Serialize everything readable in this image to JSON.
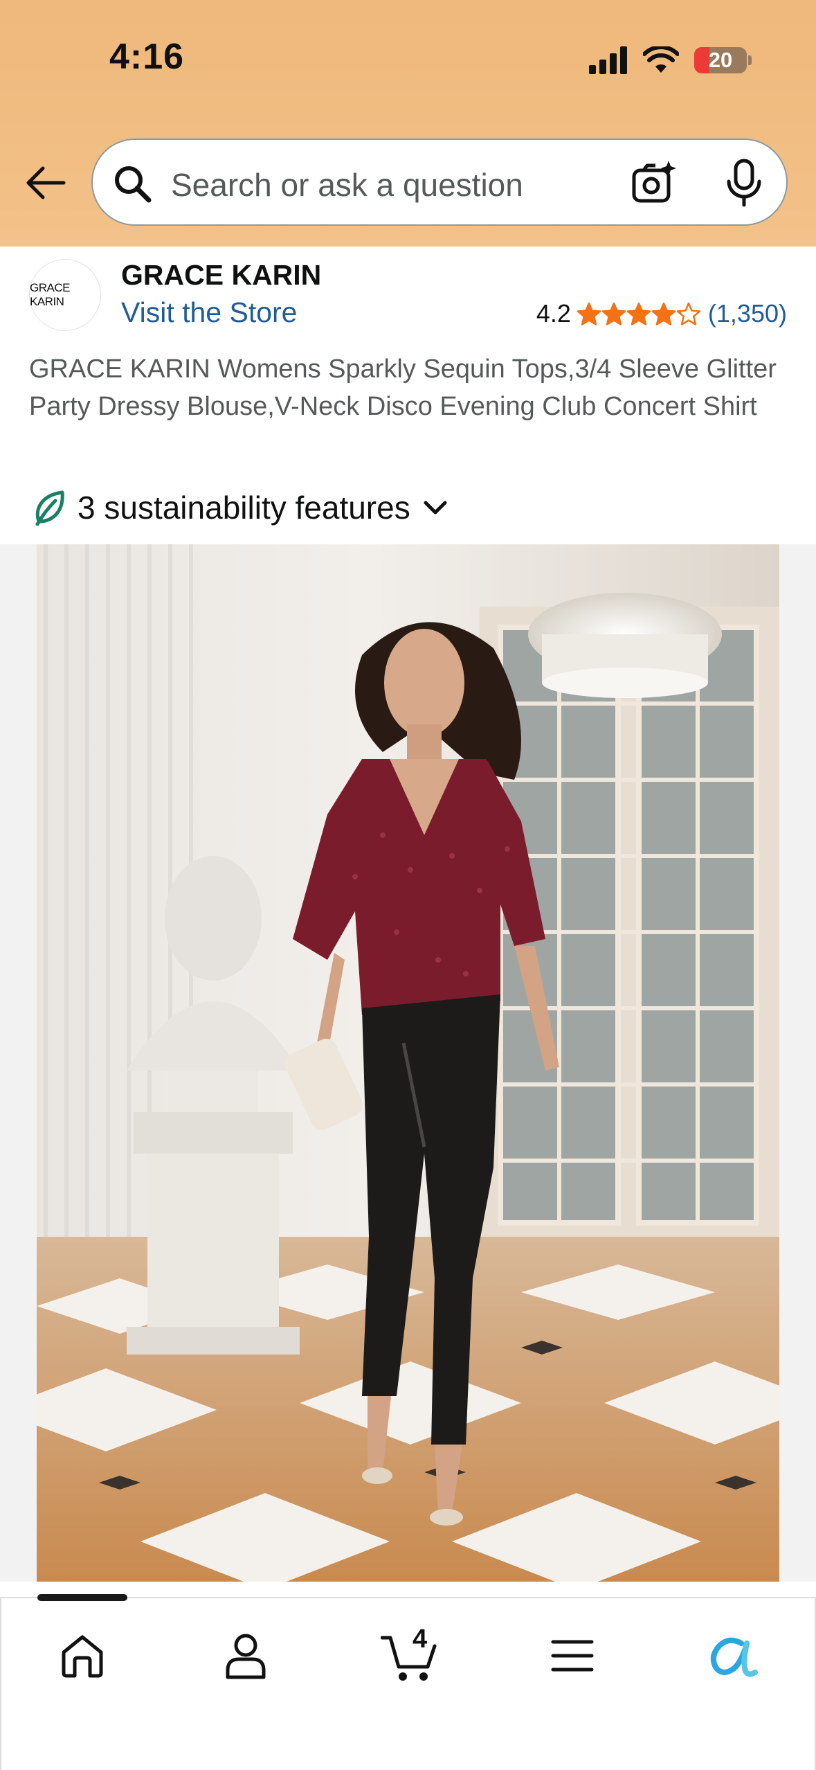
{
  "status_bar": {
    "time": "4:16",
    "battery_level": "20"
  },
  "search": {
    "placeholder": "Search or ask a question"
  },
  "brand": {
    "logo_text": "GRACE KARIN",
    "name": "GRACE KARIN",
    "store_link": "Visit the Store"
  },
  "rating": {
    "value": "4.2",
    "stars": 4.2,
    "count": "(1,350)"
  },
  "product": {
    "title": "GRACE KARIN Womens Sparkly Sequin Tops,3/4 Sleeve Glitter Party Dressy Blouse,V-Neck Disco Evening Club Concert Shirt"
  },
  "sustainability": {
    "label": "3 sustainability features"
  },
  "tabbar": {
    "items": [
      "home-icon",
      "account-icon",
      "cart-icon",
      "menu-icon",
      "rufus-icon"
    ],
    "cart_count": "4"
  },
  "colors": {
    "header_bg": "#f1bd82",
    "link": "#1f5c99",
    "star": "#f27215",
    "leaf": "#1a7f64",
    "rufus": "#2aa7e0",
    "sequin_top": "#7a1c2b"
  }
}
